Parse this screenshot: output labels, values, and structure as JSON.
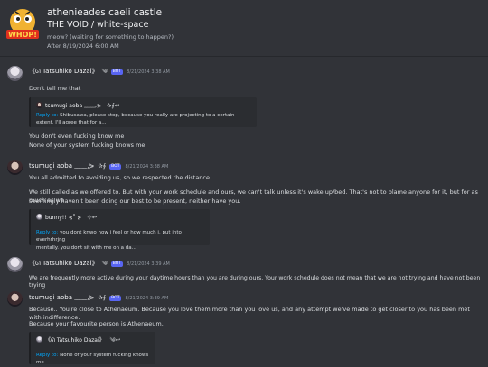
{
  "header": {
    "server_name": "athenieades caeli castle",
    "channel": "THE VOID / white-space",
    "topic": "meow? (waiting for something to happen?)",
    "after": "After 8/19/2024 6:00 AM",
    "icon_name": "server-logo-icon",
    "icon_text": "WHOP!"
  },
  "messages": [
    {
      "author": "《ᘏ Tatsuhiko Dazai》",
      "deco": "༄",
      "bot": "BOT",
      "timestamp": "8/21/2024 3:38 AM",
      "lines": [
        "Don't tell me that"
      ],
      "embed": {
        "author": "tsumugi aoba ﹏﹏,⋟",
        "deco": "✰∮↩",
        "reply_label": "Reply to:",
        "text": "Shibusawa, please stop, because you really are projecting to a certain extent. I'll agree that for a..."
      },
      "after_lines": [
        "You don't even fucking know me",
        "None of your system fucking knows me"
      ]
    },
    {
      "author": "tsumugi aoba ﹏﹏,⋟",
      "deco": "✰∮",
      "bot": "BOT",
      "timestamp": "8/21/2024 3:38 AM",
      "lines": [
        "You all admitted to avoiding us, so we respected the distance.",
        "We still called as we offered to. But with your work schedule and ours, we can't talk unless it's wake up/bed. That's not to blame anyone for it, but for as much as we",
        "seemingly haven't been doing our best to be present, neither have you."
      ],
      "embed": {
        "author": "bunny!! ⊰˚ ⊱",
        "deco": "⊹↩",
        "reply_label": "Reply to:",
        "text_lines": [
          "you dont knwo how i feel or how much i. put into everhrhrjng",
          "mentally. you dont sit with me on a da..."
        ]
      }
    },
    {
      "author": "《ᘏ Tatsuhiko Dazai》",
      "deco": "༄",
      "bot": "BOT",
      "timestamp": "8/21/2024 3:39 AM",
      "lines": [
        "We are frequently more active during your daytime hours than you are during ours. Your work schedule does not mean that we are not trying and have not been trying"
      ]
    },
    {
      "author": "tsumugi aoba ﹏﹏,⋟",
      "deco": "✰∮",
      "bot": "BOT",
      "timestamp": "8/21/2024 3:39 AM",
      "lines": [
        "Because.. You're close to Athenaeum. Because you love them more than you love us, and any attempt we've made to get closer to you has been met with indifference.",
        "Because your favourite person is Athenaeum."
      ],
      "embed": {
        "author": "《ᘏ Tatsuhiko Dazai》",
        "deco": "༄↩",
        "reply_label": "Reply to:",
        "text": "None of your system fucking knows me"
      }
    }
  ]
}
